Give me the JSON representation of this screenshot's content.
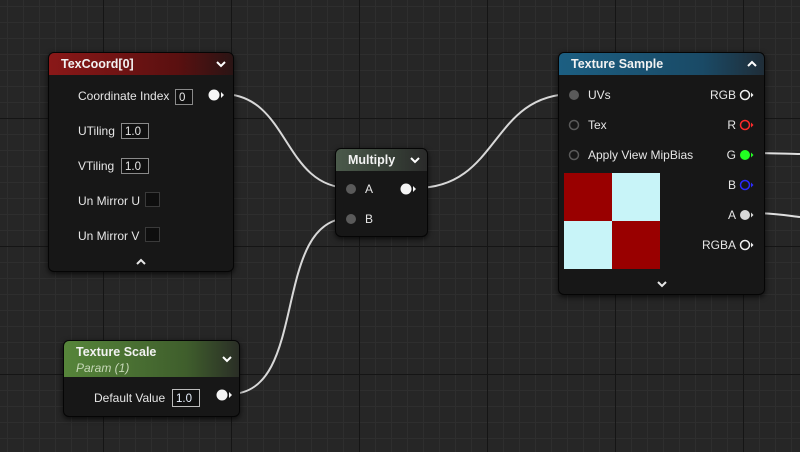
{
  "texcoord": {
    "title": "TexCoord[0]",
    "coordinate_index_label": "Coordinate Index",
    "coordinate_index_value": "0",
    "utiling_label": "UTiling",
    "utiling_value": "1.0",
    "vtiling_label": "VTiling",
    "vtiling_value": "1.0",
    "unmirror_u_label": "Un Mirror U",
    "unmirror_v_label": "Un Mirror V"
  },
  "multiply": {
    "title": "Multiply",
    "input_a": "A",
    "input_b": "B"
  },
  "texture_scale": {
    "title": "Texture Scale",
    "subtitle": "Param (1)",
    "default_value_label": "Default Value",
    "default_value": "1.0"
  },
  "texture_sample": {
    "title": "Texture Sample",
    "inputs": [
      "UVs",
      "Tex",
      "Apply View MipBias"
    ],
    "outputs": [
      "RGB",
      "R",
      "G",
      "B",
      "A",
      "RGBA"
    ]
  },
  "colors": {
    "pin_red": "#ff2a2a",
    "pin_green": "#22ff22",
    "pin_blue": "#2a2aff",
    "checker_red": "#990000",
    "checker_cyan": "#c8f4f8"
  }
}
